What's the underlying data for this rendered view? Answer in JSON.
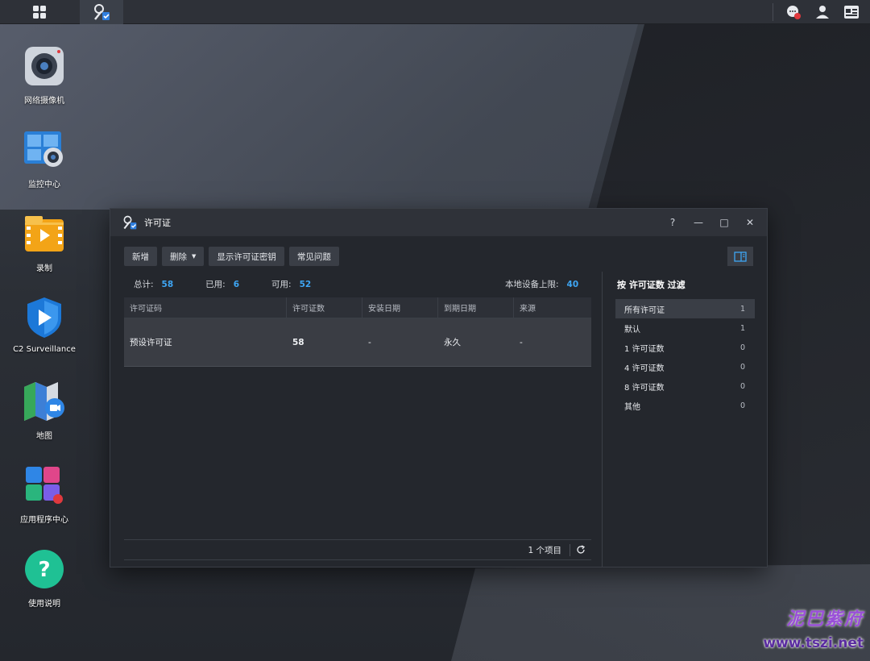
{
  "taskbar": {
    "main_menu_icon": "grid-icon",
    "active_app_icon": "license-key-icon",
    "right_icons": [
      "chat-icon",
      "user-icon",
      "widgets-icon"
    ]
  },
  "desktop": {
    "icons": [
      {
        "label": "网络摄像机",
        "icon": "camera-icon"
      },
      {
        "label": "监控中心",
        "icon": "monitor-center-icon"
      },
      {
        "label": "录制",
        "icon": "recording-icon"
      },
      {
        "label": "C2 Surveillance",
        "icon": "c2-shield-icon"
      },
      {
        "label": "地图",
        "icon": "map-icon"
      },
      {
        "label": "应用程序中心",
        "icon": "app-center-icon"
      },
      {
        "label": "使用说明",
        "icon": "help-icon"
      }
    ]
  },
  "window": {
    "title": "许可证",
    "controls": {
      "help": "?",
      "minimize": "—",
      "maximize": "□",
      "close": "✕"
    },
    "toolbar": {
      "add": "新增",
      "delete": "删除",
      "show_key": "显示许可证密钥",
      "faq": "常见问题"
    },
    "stats": {
      "total_label": "总计:",
      "total_value": "58",
      "used_label": "已用:",
      "used_value": "6",
      "available_label": "可用:",
      "available_value": "52",
      "limit_label": "本地设备上限:",
      "limit_value": "40"
    },
    "table": {
      "headers": [
        "许可证码",
        "许可证数",
        "安装日期",
        "到期日期",
        "来源"
      ],
      "rows": [
        {
          "code": "预设许可证",
          "count": "58",
          "install": "-",
          "expire": "永久",
          "source": "-"
        }
      ]
    },
    "footer": {
      "count": "1 个项目"
    },
    "filter": {
      "title": "按 许可证数 过滤",
      "items": [
        {
          "label": "所有许可证",
          "count": "1"
        },
        {
          "label": "默认",
          "count": "1"
        },
        {
          "label": "1 许可证数",
          "count": "0"
        },
        {
          "label": "4 许可证数",
          "count": "0"
        },
        {
          "label": "8 许可证数",
          "count": "0"
        },
        {
          "label": "其他",
          "count": "0"
        }
      ]
    }
  },
  "watermark": {
    "text": "泥巴紫府",
    "url": "www.tszi.net"
  }
}
